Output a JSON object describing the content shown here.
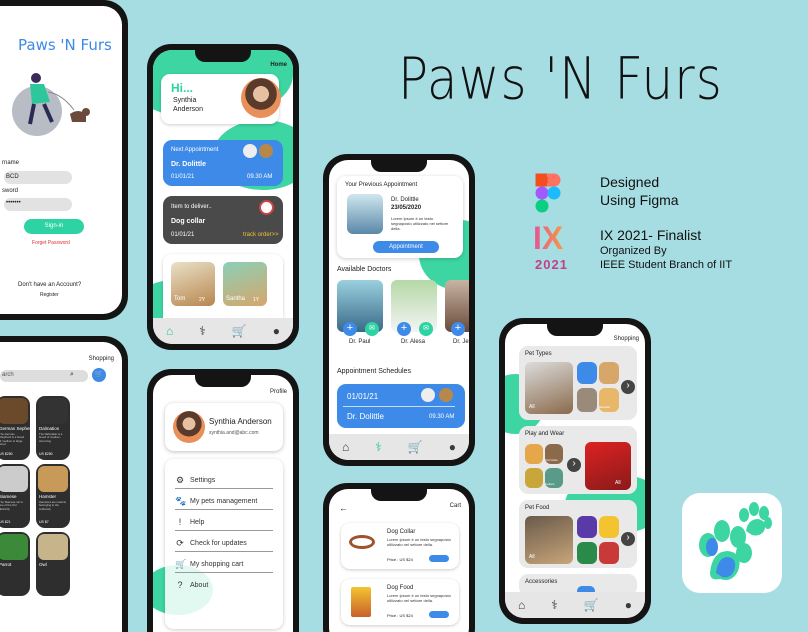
{
  "title": "Paws 'N Furs",
  "design": {
    "line1": "Designed",
    "line2": "Using Figma"
  },
  "award": {
    "logo_top": "IX",
    "logo_year": "2021",
    "line1": "IX 2021- Finalist",
    "line2": "Organized By",
    "line3": "IEEE Student Branch of IIT"
  },
  "colors": {
    "background": "#a6dde3",
    "accent": "#3dd6a3",
    "blue": "#3d8ae8"
  },
  "login": {
    "app_name": "Paws 'N Furs",
    "username_label": "rname",
    "username_value": "BCD",
    "password_label": "sword",
    "password_value": "•••••••",
    "signin": "Sign-in",
    "forgot": "Forget Password",
    "no_account": "Don't have an Account?",
    "register": "Register"
  },
  "home": {
    "header": "Home",
    "hi": "Hi...",
    "name_line1": "Synthia",
    "name_line2": "Anderson",
    "next_label": "Next Appointment",
    "doctor": "Dr. Dolittle",
    "date": "01/01/21",
    "time": "09.30 AM",
    "deliver_label": "Item to deliver..",
    "item": "Dog collar",
    "item_date": "01/01/21",
    "track": "track order>>",
    "pet1": "Tom",
    "pet1_age": "2Y",
    "pet2": "Santha",
    "pet2_age": "1Y"
  },
  "appointments": {
    "prev_title": "Your Previous Appointment",
    "prev_doctor": "Dr. Dolittle",
    "prev_date": "23/05/2020",
    "prev_desc": "Lorem Ipsum è un testo segnaposto utilizzato nel settore della.",
    "appt_button": "Appointment",
    "available": "Available Doctors",
    "doc1": "Dr. Paul",
    "doc2": "Dr. Alesa",
    "doc3": "Dr. Je",
    "schedules": "Appointment Schedules",
    "sched_date": "01/01/21",
    "sched_doctor": "Dr. Dolittle",
    "sched_time": "09.30 AM"
  },
  "shopping_left": {
    "header": "Shopping",
    "search_placeholder": "arch",
    "items": [
      {
        "name": "h Back",
        "desc": "",
        "price": ""
      },
      {
        "name": "German Sepherd",
        "desc": "The German Shepherd is a breed of medium to large-sized",
        "price": "US $250"
      },
      {
        "name": "Dalmation",
        "desc": "The Dalmatian is a breed of medium-sized dog",
        "price": "US $250"
      },
      {
        "name": "sian cat",
        "desc": "",
        "price": "US $21"
      },
      {
        "name": "Siamese",
        "desc": "The Siamese cat is one of the first distinctly",
        "price": "US $21"
      },
      {
        "name": "Hamster",
        "desc": "Hamsters are rodents belonging to the subfamily",
        "price": "US $7"
      },
      {
        "name": "r Tortoise",
        "desc": "",
        "price": ""
      },
      {
        "name": "Parrot",
        "desc": "",
        "price": ""
      },
      {
        "name": "Owl",
        "desc": "",
        "price": ""
      }
    ]
  },
  "profile": {
    "header": "Profile",
    "name": "Synthia Anderson",
    "email": "synthia.and@abc.com",
    "menu": [
      {
        "icon": "⚙",
        "label": "Settings"
      },
      {
        "icon": "🐾",
        "label": "My pets management"
      },
      {
        "icon": "!",
        "label": "Help"
      },
      {
        "icon": "⟳",
        "label": "Check for updates"
      },
      {
        "icon": "🛒",
        "label": "My shopping cart"
      },
      {
        "icon": "?",
        "label": "About"
      }
    ]
  },
  "cart": {
    "header": "Cart",
    "back": "←",
    "item1": "Dog Collar",
    "item1_desc": "Lorem Ipsum è un testo segnaposto utilizzato nel settore della.",
    "item1_price": "Price : US $24",
    "item2": "Dog Food",
    "item2_desc": "Lorem Ipsum è un testo segnaposto utilizzato nel settore della.",
    "item2_price": "Price : US $24"
  },
  "shopping_right": {
    "header": "Shopping",
    "pet_types": "Pet Types",
    "pet_all": "All",
    "play_wear": "Play and Wear",
    "play_all": "All",
    "pet_food": "Pet Food",
    "food_all": "All",
    "accessories": "Accessories",
    "sub1": "Hamster",
    "sub2": "Cat Cubs",
    "sub3": "Collars",
    "next": "›"
  },
  "icons": {
    "nav_home": "home-icon",
    "nav_doctor": "doctor-icon",
    "nav_cart": "cart-icon",
    "nav_user": "user-icon"
  }
}
